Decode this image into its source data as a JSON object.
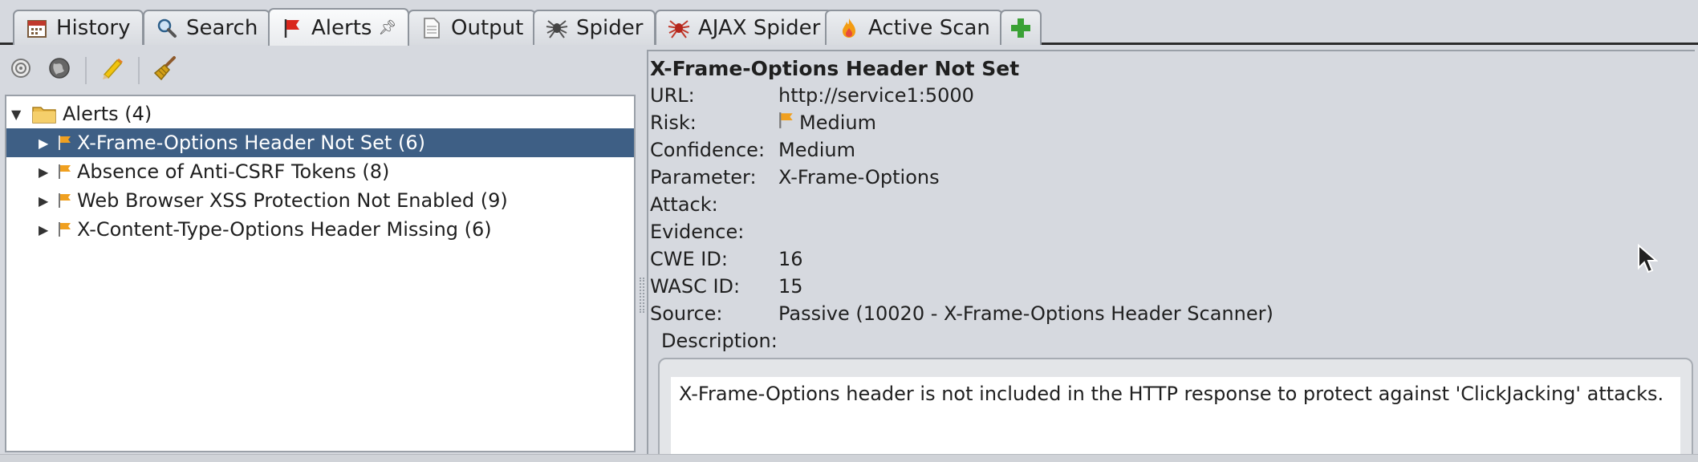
{
  "tabs": [
    {
      "label": "History",
      "icon": "calendar-icon",
      "active": false
    },
    {
      "label": "Search",
      "icon": "magnifier-icon",
      "active": false
    },
    {
      "label": "Alerts",
      "icon": "red-flag-icon",
      "active": true
    },
    {
      "label": "Output",
      "icon": "document-icon",
      "active": false
    },
    {
      "label": "Spider",
      "icon": "spider-icon",
      "active": false
    },
    {
      "label": "AJAX Spider",
      "icon": "red-spider-icon",
      "active": false
    },
    {
      "label": "Active Scan",
      "icon": "flame-icon",
      "active": false
    }
  ],
  "add_tab_icon": "plus-icon",
  "toolbar": {
    "buttons": [
      "target-icon",
      "globe-icon",
      "pencil-icon",
      "broom-icon"
    ]
  },
  "alerts_tree": {
    "root_label": "Alerts (4)",
    "items": [
      {
        "label": "X-Frame-Options Header Not Set (6)",
        "selected": true
      },
      {
        "label": "Absence of Anti-CSRF Tokens (8)",
        "selected": false
      },
      {
        "label": "Web Browser XSS Protection Not Enabled (9)",
        "selected": false
      },
      {
        "label": "X-Content-Type-Options Header Missing (6)",
        "selected": false
      }
    ]
  },
  "detail": {
    "title": "X-Frame-Options Header Not Set",
    "fields": {
      "url_label": "URL:",
      "url_value": "http://service1:5000",
      "risk_label": "Risk:",
      "risk_value": "Medium",
      "confidence_label": "Confidence:",
      "confidence_value": "Medium",
      "parameter_label": "Parameter:",
      "parameter_value": "X-Frame-Options",
      "attack_label": "Attack:",
      "attack_value": "",
      "evidence_label": "Evidence:",
      "evidence_value": "",
      "cwe_label": "CWE ID:",
      "cwe_value": "16",
      "wasc_label": "WASC ID:",
      "wasc_value": "15",
      "source_label": "Source:",
      "source_value": "Passive (10020 - X-Frame-Options Header Scanner)"
    },
    "description_label": "Description:",
    "description_text": "X-Frame-Options header is not included in the HTTP response to protect against 'ClickJacking' attacks."
  },
  "colors": {
    "selection": "#3e5f85",
    "medium_flag": "#f0a020",
    "background": "#d6d9df"
  }
}
